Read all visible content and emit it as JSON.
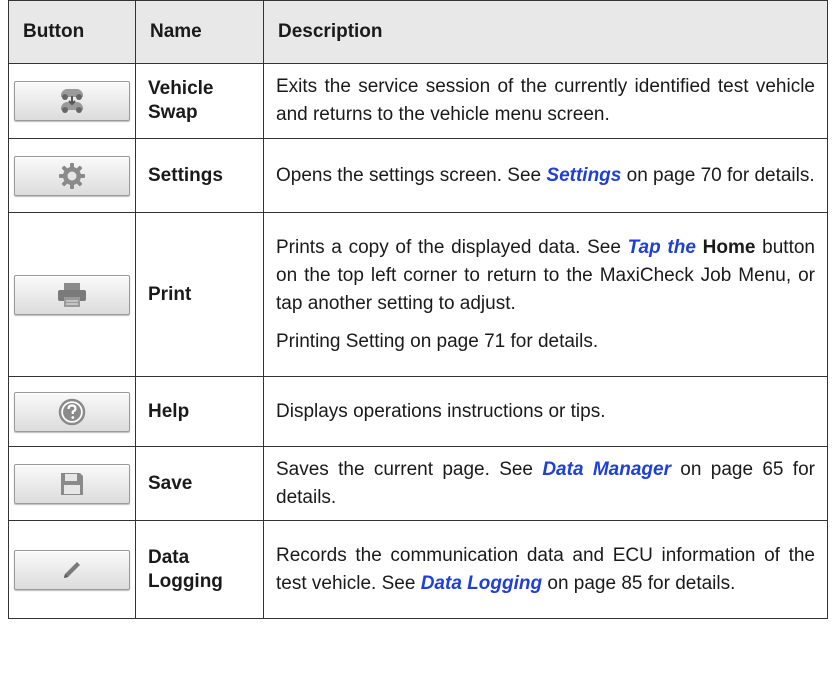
{
  "headers": {
    "button": "Button",
    "name": "Name",
    "description": "Description"
  },
  "rows": [
    {
      "icon": "vehicle-swap-icon",
      "name": "Vehicle Swap",
      "desc": "Exits the service session of the currently identified test vehicle and returns to the vehicle menu screen."
    },
    {
      "icon": "gear-icon",
      "name": "Settings",
      "desc_pre": "Opens the settings screen. See ",
      "desc_link": "Settings",
      "desc_post": " on page 70 for details."
    },
    {
      "icon": "printer-icon",
      "name": "Print",
      "desc_pre": "Prints a copy of the displayed data. See ",
      "desc_link": "Tap the",
      "desc_mid": " ",
      "desc_bold": "Home",
      "desc_post": " button on the top left corner to return to the MaxiCheck Job Menu, or tap another setting to adjust.",
      "desc2": "Printing Setting on page 71 for details."
    },
    {
      "icon": "help-icon",
      "name": "Help",
      "desc": "Displays operations instructions or tips."
    },
    {
      "icon": "save-icon",
      "name": "Save",
      "desc_pre": "Saves the current page. See ",
      "desc_link": "Data Manager",
      "desc_post": " on page 65 for details."
    },
    {
      "icon": "pencil-icon",
      "name": "Data Logging",
      "desc_pre": "Records the communication data and ECU information of the test vehicle. See ",
      "desc_link": "Data Logging",
      "desc_post": " on page 85 for details."
    }
  ]
}
